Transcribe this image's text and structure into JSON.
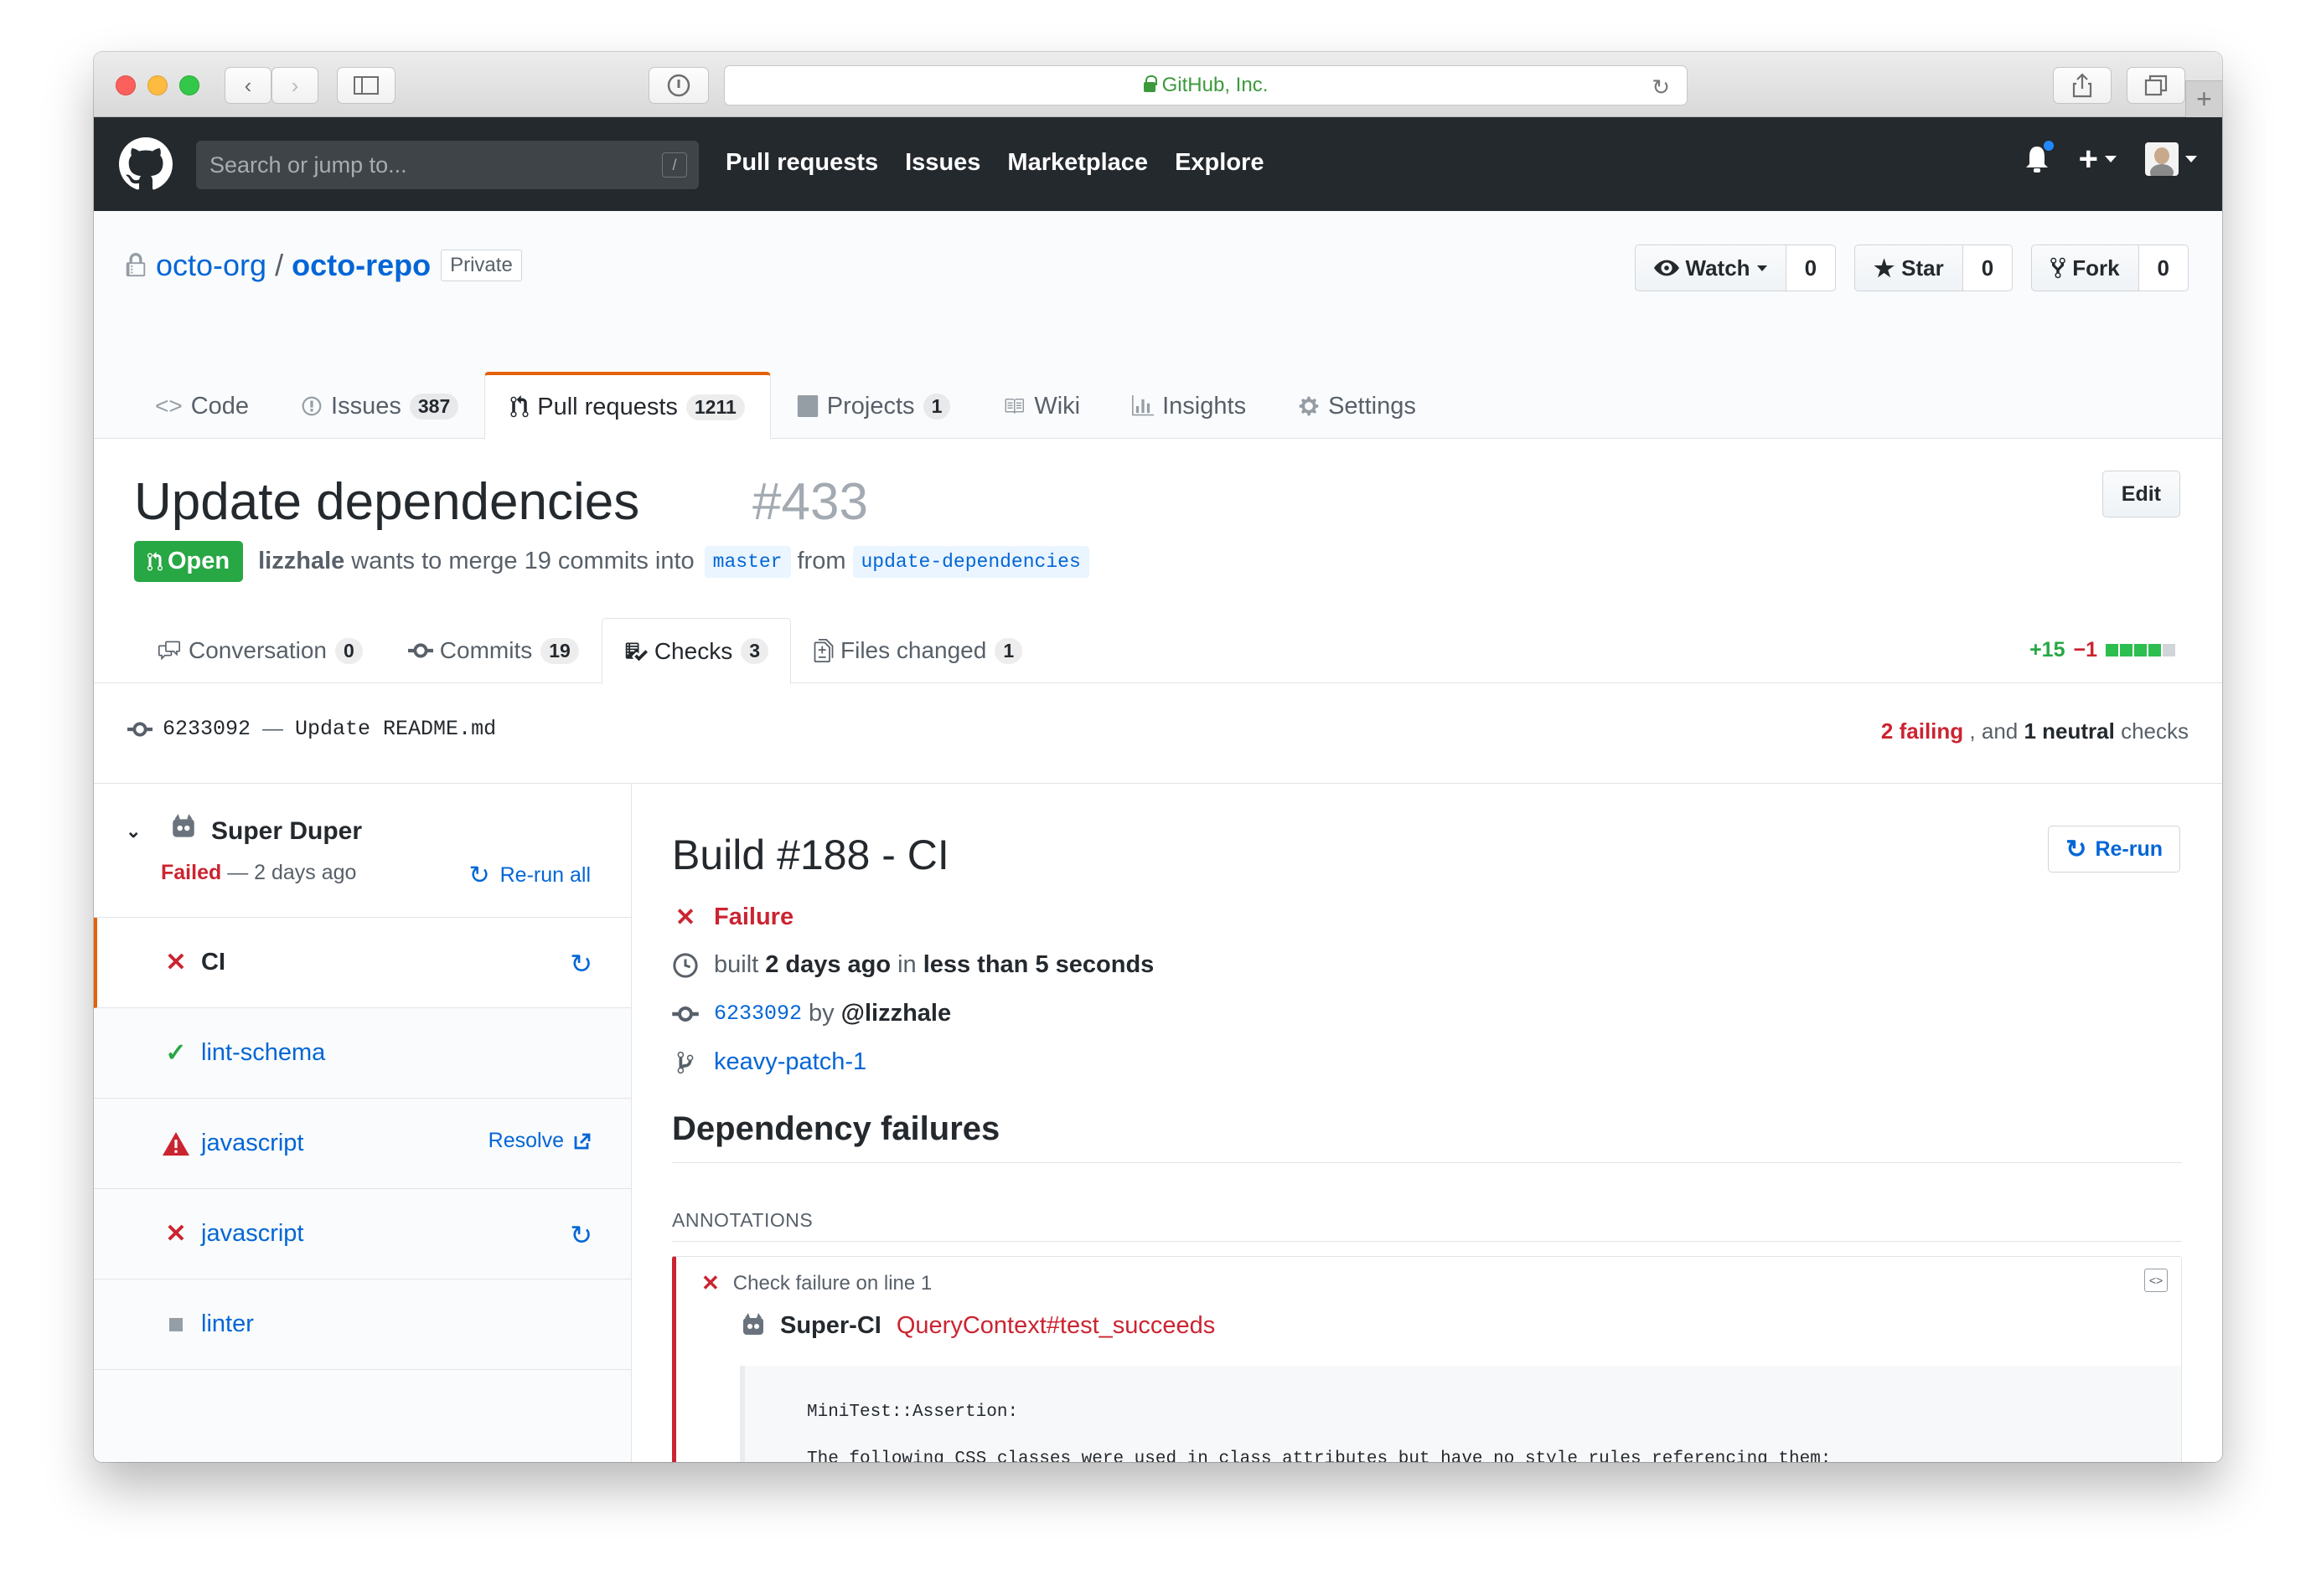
{
  "browser": {
    "url_title": "GitHub, Inc."
  },
  "header": {
    "search_placeholder": "Search or jump to...",
    "search_shortcut": "/",
    "nav": [
      "Pull requests",
      "Issues",
      "Marketplace",
      "Explore"
    ]
  },
  "repo": {
    "owner": "octo-org",
    "separator": "/",
    "name": "octo-repo",
    "visibility": "Private",
    "actions": [
      {
        "label": "Watch",
        "count": "0"
      },
      {
        "label": "Star",
        "count": "0"
      },
      {
        "label": "Fork",
        "count": "0"
      }
    ],
    "tabs": [
      {
        "label": "Code",
        "icon": "code-icon",
        "counter": ""
      },
      {
        "label": "Issues",
        "icon": "issue-icon",
        "counter": "387"
      },
      {
        "label": "Pull requests",
        "icon": "pull-request-icon",
        "counter": "1211"
      },
      {
        "label": "Projects",
        "icon": "project-icon",
        "counter": "1"
      },
      {
        "label": "Wiki",
        "icon": "book-icon",
        "counter": ""
      },
      {
        "label": "Insights",
        "icon": "graph-icon",
        "counter": ""
      },
      {
        "label": "Settings",
        "icon": "gear-icon",
        "counter": ""
      }
    ]
  },
  "pr": {
    "title": "Update dependencies",
    "number": "#433",
    "edit_label": "Edit",
    "state": "Open",
    "author": "lizzhale",
    "merge_text": "wants to merge 19 commits into",
    "base_branch": "master",
    "from_text": "from",
    "head_branch": "update-dependencies",
    "tabs": [
      {
        "label": "Conversation",
        "counter": "0"
      },
      {
        "label": "Commits",
        "counter": "19"
      },
      {
        "label": "Checks",
        "counter": "3"
      },
      {
        "label": "Files changed",
        "counter": "1"
      }
    ],
    "additions": "+15",
    "deletions": "−1"
  },
  "commit": {
    "sha": "6233092",
    "dash": "—",
    "message": "Update README.md",
    "failing_count": "2 failing",
    "summary_mid": ", and",
    "neutral_count": "1 neutral",
    "summary_end": "checks"
  },
  "suite": {
    "name": "Super Duper",
    "status": "Failed",
    "time": "— 2 days ago",
    "rerun_all": "Re-run all",
    "checks": [
      {
        "name": "CI",
        "status": "failure",
        "action": "rerun"
      },
      {
        "name": "lint-schema",
        "status": "success",
        "action": ""
      },
      {
        "name": "javascript",
        "status": "action_required",
        "action": "Resolve"
      },
      {
        "name": "javascript",
        "status": "failure",
        "action": "rerun"
      },
      {
        "name": "linter",
        "status": "neutral",
        "action": ""
      }
    ]
  },
  "build": {
    "title": "Build #188 - CI",
    "rerun_label": "Re-run",
    "conclusion": "Failure",
    "built_prefix": "built",
    "built_ago": "2 days ago",
    "built_mid": "in",
    "duration": "less than 5 seconds",
    "sha": "6233092",
    "by": "by",
    "user": "@lizzhale",
    "branch": "keavy-patch-1",
    "section_title": "Dependency failures",
    "annotations_label": "ANNOTATIONS",
    "annotation": {
      "heading": "Check failure on line 1",
      "app": "Super-CI",
      "test": "QueryContext#test_succeeds",
      "lines": [
        "MiniTest::Assertion:",
        "The following CSS classes were used in class attributes but have no style rules referencing them:"
      ]
    }
  },
  "colors": {
    "accent_orange": "#e36209",
    "link_blue": "#0366d6",
    "fail_red": "#cb2431",
    "success_green": "#28a745",
    "header_dark": "#24292e"
  }
}
